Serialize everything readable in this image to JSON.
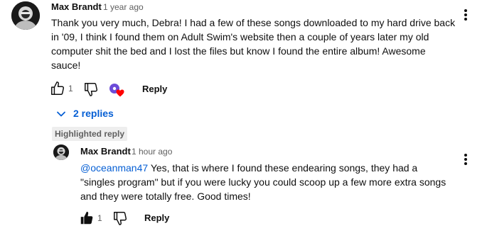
{
  "comment": {
    "author": "Max Brandt",
    "time": "1 year ago",
    "text_lines": [
      "Thank you very much, Debra! I had a few of these songs downloaded to my hard drive back",
      "in '09, I think I found them on Adult Swim's website then a couple of years later my old",
      "computer shit the bed and I lost the files but know I found the entire album! Awesome",
      "sauce!"
    ],
    "like_count": "1",
    "reply_label": "Reply",
    "creator_heart_icon": "heart-icon"
  },
  "replies_toggle": {
    "label": "2 replies",
    "icon": "chevron-down-icon"
  },
  "highlighted_label": "Highlighted reply",
  "reply": {
    "author": "Max Brandt",
    "time": "1 hour ago",
    "mention": "@oceanman47",
    "text_lines": [
      "Yes, that is where I found these endearing songs, they had a",
      "\"singles program\" but if you were lucky you could scoop up a few more extra songs",
      "and they were totally free. Good times!"
    ],
    "like_count": "1",
    "reply_label": "Reply"
  },
  "colors": {
    "link_blue": "#065fd4",
    "heart_red": "#ff0000",
    "creator_avatar_purple": "#6c4bd8"
  }
}
